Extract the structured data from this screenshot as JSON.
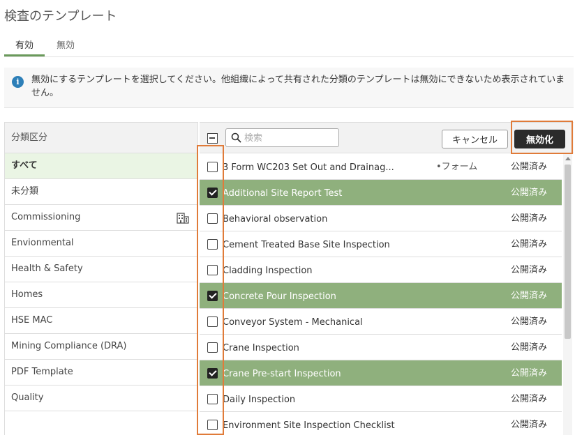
{
  "page": {
    "title": "検査のテンプレート"
  },
  "tabs": [
    {
      "label": "有効",
      "active": true
    },
    {
      "label": "無効",
      "active": false
    }
  ],
  "info": {
    "message": "無効にするテンプレートを選択してください。他組織によって共有された分類のテンプレートは無効にできないため表示されていません。"
  },
  "categories": {
    "header": "分類区分",
    "items": [
      {
        "label": "すべて",
        "active": true
      },
      {
        "label": "未分類"
      },
      {
        "label": "Commissioning",
        "icon": "building-icon"
      },
      {
        "label": "Envionmental"
      },
      {
        "label": "Health & Safety"
      },
      {
        "label": "Homes"
      },
      {
        "label": "HSE MAC"
      },
      {
        "label": "Mining Compliance (DRA)"
      },
      {
        "label": "PDF Template"
      },
      {
        "label": "Quality"
      }
    ]
  },
  "toolbar": {
    "search_placeholder": "検索",
    "cancel_label": "キャンセル",
    "disable_label": "無効化"
  },
  "templates": [
    {
      "name": "3 Form WC203 Set Out and Drainag...",
      "tag": "•フォーム",
      "status": "公開済み",
      "checked": false
    },
    {
      "name": "Additional Site Report Test",
      "tag": "",
      "status": "公開済み",
      "checked": true
    },
    {
      "name": "Behavioral observation",
      "tag": "",
      "status": "公開済み",
      "checked": false
    },
    {
      "name": "Cement Treated Base Site Inspection",
      "tag": "",
      "status": "公開済み",
      "checked": false
    },
    {
      "name": "Cladding Inspection",
      "tag": "",
      "status": "公開済み",
      "checked": false
    },
    {
      "name": "Concrete Pour Inspection",
      "tag": "",
      "status": "公開済み",
      "checked": true
    },
    {
      "name": "Conveyor System - Mechanical",
      "tag": "",
      "status": "公開済み",
      "checked": false
    },
    {
      "name": "Crane Inspection",
      "tag": "",
      "status": "公開済み",
      "checked": false
    },
    {
      "name": "Crane Pre-start Inspection",
      "tag": "",
      "status": "公開済み",
      "checked": true
    },
    {
      "name": "Daily Inspection",
      "tag": "",
      "status": "公開済み",
      "checked": false
    },
    {
      "name": "Environment Site Inspection Checklist",
      "tag": "",
      "status": "公開済み",
      "checked": false
    }
  ],
  "colors": {
    "accent_green": "#6a9a5b",
    "selected_row": "#8fb07d",
    "highlight_orange": "#e07b39",
    "primary_button": "#2b2b2b"
  }
}
